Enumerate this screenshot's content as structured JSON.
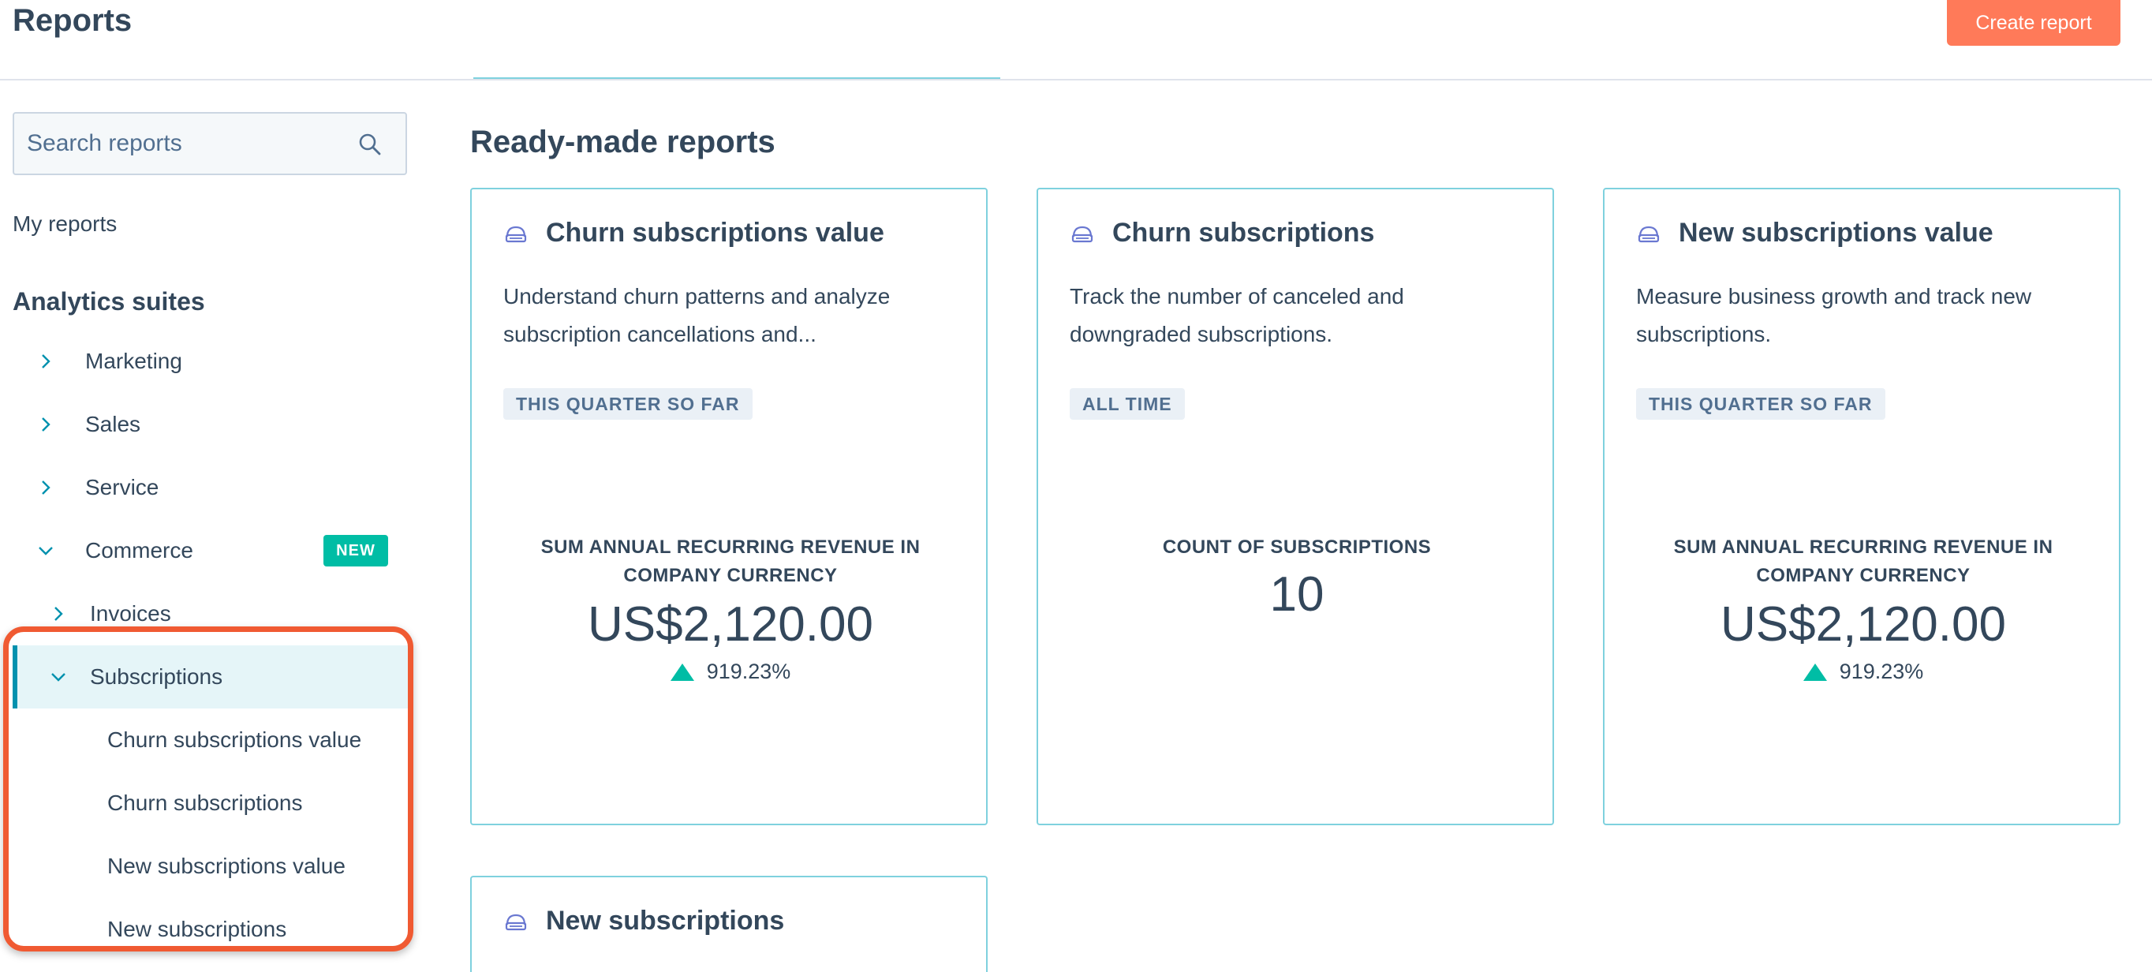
{
  "header": {
    "title": "Reports",
    "create_button": "Create report"
  },
  "sidebar": {
    "search_placeholder": "Search reports",
    "my_reports": "My reports",
    "section_title": "Analytics suites",
    "items": [
      {
        "label": "Marketing",
        "expanded": false
      },
      {
        "label": "Sales",
        "expanded": false
      },
      {
        "label": "Service",
        "expanded": false
      },
      {
        "label": "Commerce",
        "expanded": true,
        "badge": "NEW"
      }
    ],
    "commerce_children": [
      {
        "label": "Invoices",
        "expanded": false
      },
      {
        "label": "Subscriptions",
        "expanded": true,
        "selected": true
      }
    ],
    "subscription_reports": [
      "Churn subscriptions value",
      "Churn subscriptions",
      "New subscriptions value",
      "New subscriptions"
    ]
  },
  "main": {
    "heading": "Ready-made reports",
    "cards": [
      {
        "title": "Churn subscriptions value",
        "description": "Understand churn patterns and analyze subscription cancellations and...",
        "tag": "THIS QUARTER SO FAR",
        "metric_label": "SUM ANNUAL RECURRING REVENUE IN COMPANY CURRENCY",
        "metric_value": "US$2,120.00",
        "metric_change": "919.23%"
      },
      {
        "title": "Churn subscriptions",
        "description": "Track the number of canceled and downgraded subscriptions.",
        "tag": "ALL TIME",
        "metric_label": "COUNT OF SUBSCRIPTIONS",
        "metric_value": "10"
      },
      {
        "title": "New subscriptions value",
        "description": "Measure business growth and track new subscriptions.",
        "tag": "THIS QUARTER SO FAR",
        "metric_label": "SUM ANNUAL RECURRING REVENUE IN COMPANY CURRENCY",
        "metric_value": "US$2,120.00",
        "metric_change": "919.23%"
      },
      {
        "title": "New subscriptions"
      }
    ]
  },
  "colors": {
    "accent": "#ff7a59",
    "card_border": "#7fd1de",
    "positive": "#00bda5",
    "highlight": "#f05a32",
    "text": "#33475b"
  }
}
